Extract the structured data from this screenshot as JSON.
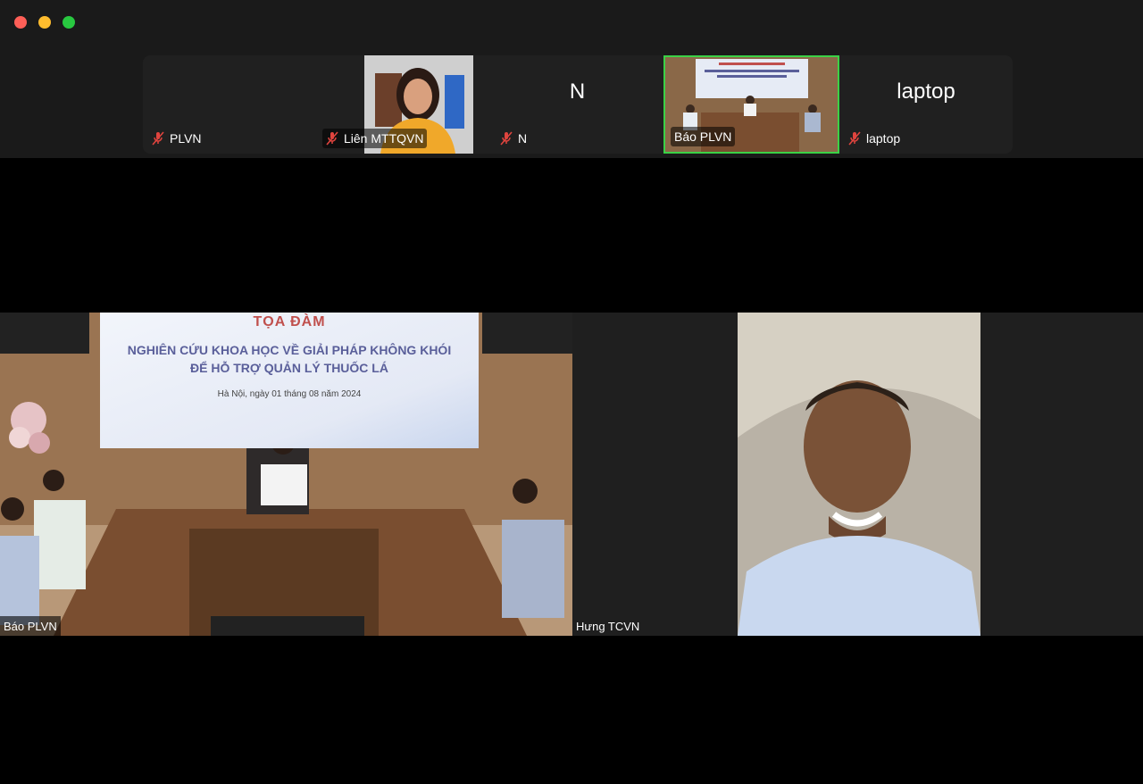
{
  "window": {
    "controls": [
      "close",
      "minimize",
      "zoom"
    ]
  },
  "participants_strip": [
    {
      "name": "PLVN",
      "big_label": "",
      "muted": true
    },
    {
      "name": "Liên MTTQVN",
      "big_label": "",
      "muted": true
    },
    {
      "name": "N",
      "big_label": "N",
      "muted": true
    },
    {
      "name": "Báo PLVN",
      "big_label": "",
      "muted": false,
      "active_speaker": true
    },
    {
      "name": "laptop",
      "big_label": "laptop",
      "muted": true
    }
  ],
  "main_videos": [
    {
      "name": "Báo PLVN",
      "banner": {
        "title": "TỌA ĐÀM",
        "line1": "NGHIÊN CỨU KHOA HỌC VỀ GIẢI PHÁP KHÔNG KHÓI",
        "line2": "ĐỂ HỖ TRỢ QUẢN LÝ THUỐC LÁ",
        "date": "Hà Nội, ngày 01 tháng 08 năm 2024"
      }
    },
    {
      "name": "Hưng TCVN"
    }
  ],
  "colors": {
    "active_border": "#3bd146",
    "muted_mic": "#e0443e"
  },
  "icons": {
    "muted": "mic-muted-icon"
  }
}
